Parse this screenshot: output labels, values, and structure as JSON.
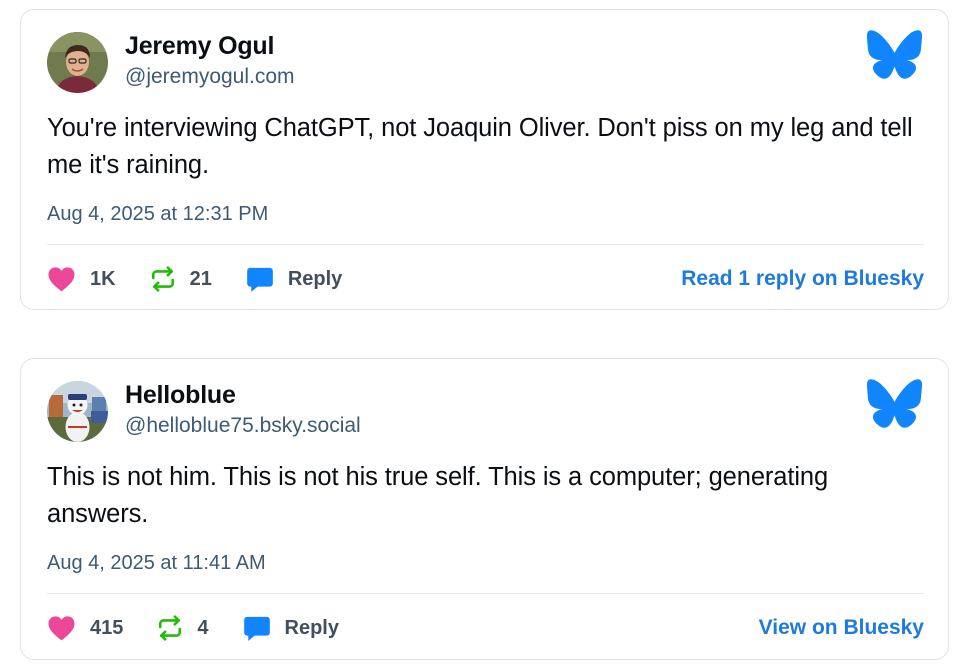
{
  "posts": [
    {
      "author_name": "Jeremy Ogul",
      "author_handle": "@jeremyogul.com",
      "text": "You're interviewing ChatGPT, not Joaquin Oliver. Don't piss on my leg and tell me it's raining.",
      "timestamp": "Aug 4, 2025 at 12:31 PM",
      "likes": "1K",
      "reposts": "21",
      "reply_label": "Reply",
      "link_label": "Read 1 reply on Bluesky"
    },
    {
      "author_name": "Helloblue",
      "author_handle": "@helloblue75.bsky.social",
      "text": "This is not him. This is not his true self. This is a computer; generating answers.",
      "timestamp": "Aug 4, 2025 at 11:41 AM",
      "likes": "415",
      "reposts": "4",
      "reply_label": "Reply",
      "link_label": "View on Bluesky"
    }
  ],
  "icons": {
    "logo": "bluesky-butterfly-icon",
    "like": "heart-icon",
    "repost": "repost-icon",
    "reply": "speech-bubble-icon"
  },
  "colors": {
    "bluesky_blue": "#1185fe",
    "like_pink": "#ec4899",
    "repost_green": "#20bc07",
    "link_blue": "#1f7ae0",
    "secondary_text": "#3e5a75"
  }
}
